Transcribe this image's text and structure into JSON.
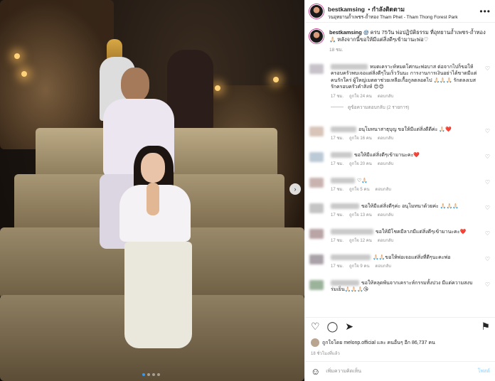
{
  "photo": {
    "carousel_next": "›"
  },
  "header": {
    "username": "bestkamsing",
    "follow": "• กำลังติดตาม",
    "location": "วนอุทยานถ้ำเพชร-ถ้ำทอง Tham Phet - Tham Thong Forest Park",
    "more": "•••"
  },
  "caption": {
    "username": "bestkamsing",
    "text": "ครบ 75วัน พ่อปฏิบัติธรรม ที่อุทยานถ้ำเพชร-ถ้ำทอง 🙏🏻 หลังจากนี้ขอให้มีแต่สิ่งดีๆเข้ามานะพ่อ♡",
    "tag": "@",
    "time": "18 ชม."
  },
  "comments": [
    {
      "text": "หมดเคราะห์หมดโศกนะพ่อบาส ต่อจากไปก็ขอให้ครอบครัวพบเจอแต่สิ่งดีๆในเร็ววันนะ การงานการเงินอย่าได้ขาดมีแต่คนรักใคร่ ผู้ใหญ่เมตตาช่วยเหลือเกื้อกูลตลอดไป 🙏🏻🙏🏻🙏🏻 รักตลงเบส รักครอบครัวคำสิงห์ 😍😍",
      "time": "17 ชม.",
      "likes": "ถูกใจ 24 คน",
      "reply": "ตอบกลับ"
    },
    {
      "text": "อนุโมทนาสาธุบุญ ขอให้มีแต่สิ่งดีดีค่ะ 🙏🏻❤️",
      "time": "17 ชม.",
      "likes": "ถูกใจ 16 คน",
      "reply": "ตอบกลับ"
    },
    {
      "text": "ขอให้มีแต่สิ่งดีๆเข้ามานะคะ❤️",
      "time": "17 ชม.",
      "likes": "ถูกใจ 20 คน",
      "reply": "ตอบกลับ"
    },
    {
      "text": "♡🙏🏻",
      "time": "17 ชม.",
      "likes": "ถูกใจ 5 คน",
      "reply": "ตอบกลับ"
    },
    {
      "text": "ขอให้มีแต่สิ่งดีๆค่ะ อนุโมทนาด้วยค่ะ 🙏🏻🙏🏻🙏🏻",
      "time": "17 ชม.",
      "likes": "ถูกใจ 13 คน",
      "reply": "ตอบกลับ"
    },
    {
      "text": "ขอให้มีโชคมีลาภมีแต่สิ่งดีๆเข้ามานะคะ❤️",
      "time": "17 ชม.",
      "likes": "ถูกใจ 12 คน",
      "reply": "ตอบกลับ"
    },
    {
      "text": "🙏🏻🙏🏻ขอให้พ่อเจอแต่สิ่งที่ดีๆนะคะพ่อ",
      "time": "17 ชม.",
      "likes": "ถูกใจ 9 คน",
      "reply": "ตอบกลับ"
    },
    {
      "text": "ขอให้หลุดพ้นจากเคราะห์กรรมทั้งปวง มีแต่ความสงบร่มเย็น🙏🏻🙏🏻🙏🏻😘",
      "time": "17 ชม.",
      "likes": "",
      "reply": ""
    }
  ],
  "replies_toggle": "ดูข้อความตอบกลับ (2 รายการ)",
  "actions": {
    "like": "♡",
    "comment": "◯",
    "share": "➤",
    "save": "⚑"
  },
  "likes": {
    "text": "ถูกใจโดย melonp.official และ คนอื่นๆ อีก 86,737 คน"
  },
  "post_time": "18 ชั่วโมงที่แล้ว",
  "add_comment": {
    "placeholder": "เพิ่มความคิดเห็น",
    "post": "โพสต์",
    "emoji": "☺"
  },
  "colors": {
    "accent": "#0095f6",
    "muted": "#8e8e8e",
    "link": "#00376b"
  }
}
